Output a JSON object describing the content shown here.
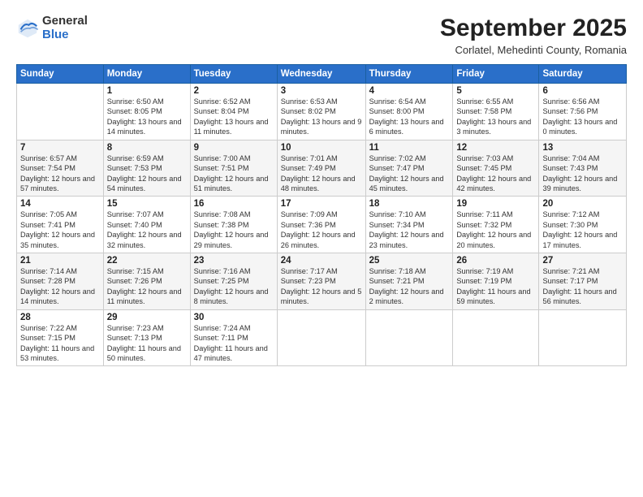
{
  "logo": {
    "general": "General",
    "blue": "Blue"
  },
  "header": {
    "month": "September 2025",
    "location": "Corlatel, Mehedinti County, Romania"
  },
  "weekdays": [
    "Sunday",
    "Monday",
    "Tuesday",
    "Wednesday",
    "Thursday",
    "Friday",
    "Saturday"
  ],
  "weeks": [
    [
      {
        "day": "",
        "info": ""
      },
      {
        "day": "1",
        "info": "Sunrise: 6:50 AM\nSunset: 8:05 PM\nDaylight: 13 hours\nand 14 minutes."
      },
      {
        "day": "2",
        "info": "Sunrise: 6:52 AM\nSunset: 8:04 PM\nDaylight: 13 hours\nand 11 minutes."
      },
      {
        "day": "3",
        "info": "Sunrise: 6:53 AM\nSunset: 8:02 PM\nDaylight: 13 hours\nand 9 minutes."
      },
      {
        "day": "4",
        "info": "Sunrise: 6:54 AM\nSunset: 8:00 PM\nDaylight: 13 hours\nand 6 minutes."
      },
      {
        "day": "5",
        "info": "Sunrise: 6:55 AM\nSunset: 7:58 PM\nDaylight: 13 hours\nand 3 minutes."
      },
      {
        "day": "6",
        "info": "Sunrise: 6:56 AM\nSunset: 7:56 PM\nDaylight: 13 hours\nand 0 minutes."
      }
    ],
    [
      {
        "day": "7",
        "info": "Sunrise: 6:57 AM\nSunset: 7:54 PM\nDaylight: 12 hours\nand 57 minutes."
      },
      {
        "day": "8",
        "info": "Sunrise: 6:59 AM\nSunset: 7:53 PM\nDaylight: 12 hours\nand 54 minutes."
      },
      {
        "day": "9",
        "info": "Sunrise: 7:00 AM\nSunset: 7:51 PM\nDaylight: 12 hours\nand 51 minutes."
      },
      {
        "day": "10",
        "info": "Sunrise: 7:01 AM\nSunset: 7:49 PM\nDaylight: 12 hours\nand 48 minutes."
      },
      {
        "day": "11",
        "info": "Sunrise: 7:02 AM\nSunset: 7:47 PM\nDaylight: 12 hours\nand 45 minutes."
      },
      {
        "day": "12",
        "info": "Sunrise: 7:03 AM\nSunset: 7:45 PM\nDaylight: 12 hours\nand 42 minutes."
      },
      {
        "day": "13",
        "info": "Sunrise: 7:04 AM\nSunset: 7:43 PM\nDaylight: 12 hours\nand 39 minutes."
      }
    ],
    [
      {
        "day": "14",
        "info": "Sunrise: 7:05 AM\nSunset: 7:41 PM\nDaylight: 12 hours\nand 35 minutes."
      },
      {
        "day": "15",
        "info": "Sunrise: 7:07 AM\nSunset: 7:40 PM\nDaylight: 12 hours\nand 32 minutes."
      },
      {
        "day": "16",
        "info": "Sunrise: 7:08 AM\nSunset: 7:38 PM\nDaylight: 12 hours\nand 29 minutes."
      },
      {
        "day": "17",
        "info": "Sunrise: 7:09 AM\nSunset: 7:36 PM\nDaylight: 12 hours\nand 26 minutes."
      },
      {
        "day": "18",
        "info": "Sunrise: 7:10 AM\nSunset: 7:34 PM\nDaylight: 12 hours\nand 23 minutes."
      },
      {
        "day": "19",
        "info": "Sunrise: 7:11 AM\nSunset: 7:32 PM\nDaylight: 12 hours\nand 20 minutes."
      },
      {
        "day": "20",
        "info": "Sunrise: 7:12 AM\nSunset: 7:30 PM\nDaylight: 12 hours\nand 17 minutes."
      }
    ],
    [
      {
        "day": "21",
        "info": "Sunrise: 7:14 AM\nSunset: 7:28 PM\nDaylight: 12 hours\nand 14 minutes."
      },
      {
        "day": "22",
        "info": "Sunrise: 7:15 AM\nSunset: 7:26 PM\nDaylight: 12 hours\nand 11 minutes."
      },
      {
        "day": "23",
        "info": "Sunrise: 7:16 AM\nSunset: 7:25 PM\nDaylight: 12 hours\nand 8 minutes."
      },
      {
        "day": "24",
        "info": "Sunrise: 7:17 AM\nSunset: 7:23 PM\nDaylight: 12 hours\nand 5 minutes."
      },
      {
        "day": "25",
        "info": "Sunrise: 7:18 AM\nSunset: 7:21 PM\nDaylight: 12 hours\nand 2 minutes."
      },
      {
        "day": "26",
        "info": "Sunrise: 7:19 AM\nSunset: 7:19 PM\nDaylight: 11 hours\nand 59 minutes."
      },
      {
        "day": "27",
        "info": "Sunrise: 7:21 AM\nSunset: 7:17 PM\nDaylight: 11 hours\nand 56 minutes."
      }
    ],
    [
      {
        "day": "28",
        "info": "Sunrise: 7:22 AM\nSunset: 7:15 PM\nDaylight: 11 hours\nand 53 minutes."
      },
      {
        "day": "29",
        "info": "Sunrise: 7:23 AM\nSunset: 7:13 PM\nDaylight: 11 hours\nand 50 minutes."
      },
      {
        "day": "30",
        "info": "Sunrise: 7:24 AM\nSunset: 7:11 PM\nDaylight: 11 hours\nand 47 minutes."
      },
      {
        "day": "",
        "info": ""
      },
      {
        "day": "",
        "info": ""
      },
      {
        "day": "",
        "info": ""
      },
      {
        "day": "",
        "info": ""
      }
    ]
  ]
}
